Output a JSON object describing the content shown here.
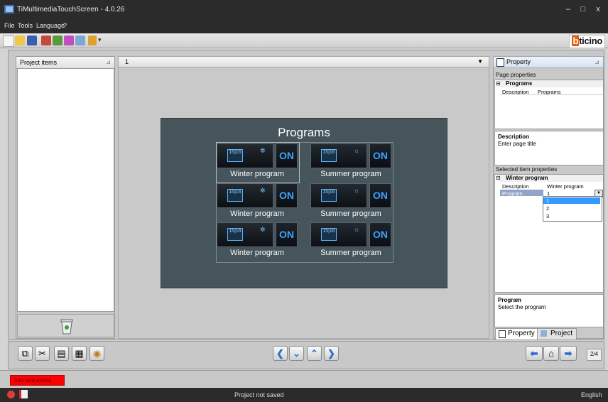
{
  "window": {
    "title": "TiMultimediaTouchScreen - 4.0.26",
    "minimize": "–",
    "maximize": "□",
    "close": "x"
  },
  "menu": [
    "File",
    "Tools",
    "Language",
    "?"
  ],
  "brand": {
    "mark": "b",
    "name": "ticino"
  },
  "left_panel": {
    "title": "Project items"
  },
  "center": {
    "page_number": "1",
    "screen": {
      "title": "Programs",
      "tiles": [
        {
          "label": "Winter program",
          "on": "ON",
          "cal1": "15",
          "cal2": "16"
        },
        {
          "label": "Summer program",
          "on": "ON",
          "cal1": "15",
          "cal2": "16"
        },
        {
          "label": "Winter program",
          "on": "ON",
          "cal1": "15",
          "cal2": "16"
        },
        {
          "label": "Summer program",
          "on": "ON",
          "cal1": "15",
          "cal2": "16"
        },
        {
          "label": "Winter program",
          "on": "ON",
          "cal1": "15",
          "cal2": "16"
        },
        {
          "label": "Summer program",
          "on": "ON",
          "cal1": "15",
          "cal2": "16"
        }
      ]
    }
  },
  "right_panel": {
    "header": "Property",
    "page_properties_label": "Page properties",
    "page_props": {
      "category": "Programs",
      "key": "Description",
      "value": "Programs"
    },
    "description_box": {
      "title": "Description",
      "text": "Enter page title"
    },
    "selected_label": "Selected item properties",
    "item_props": {
      "category": "Winter program",
      "rows": [
        {
          "key": "Description",
          "value": "Winter program"
        },
        {
          "key": "Program",
          "value": "1"
        }
      ],
      "options": [
        "1",
        "2",
        "3"
      ]
    },
    "program_box": {
      "title": "Program",
      "text": "Select the program"
    },
    "tabs": [
      "Property",
      "Project"
    ]
  },
  "bottom": {
    "page_indicator": "2/4"
  },
  "info": {
    "button": "Info and errors"
  },
  "status": {
    "text": "Project not saved",
    "language": "English"
  }
}
